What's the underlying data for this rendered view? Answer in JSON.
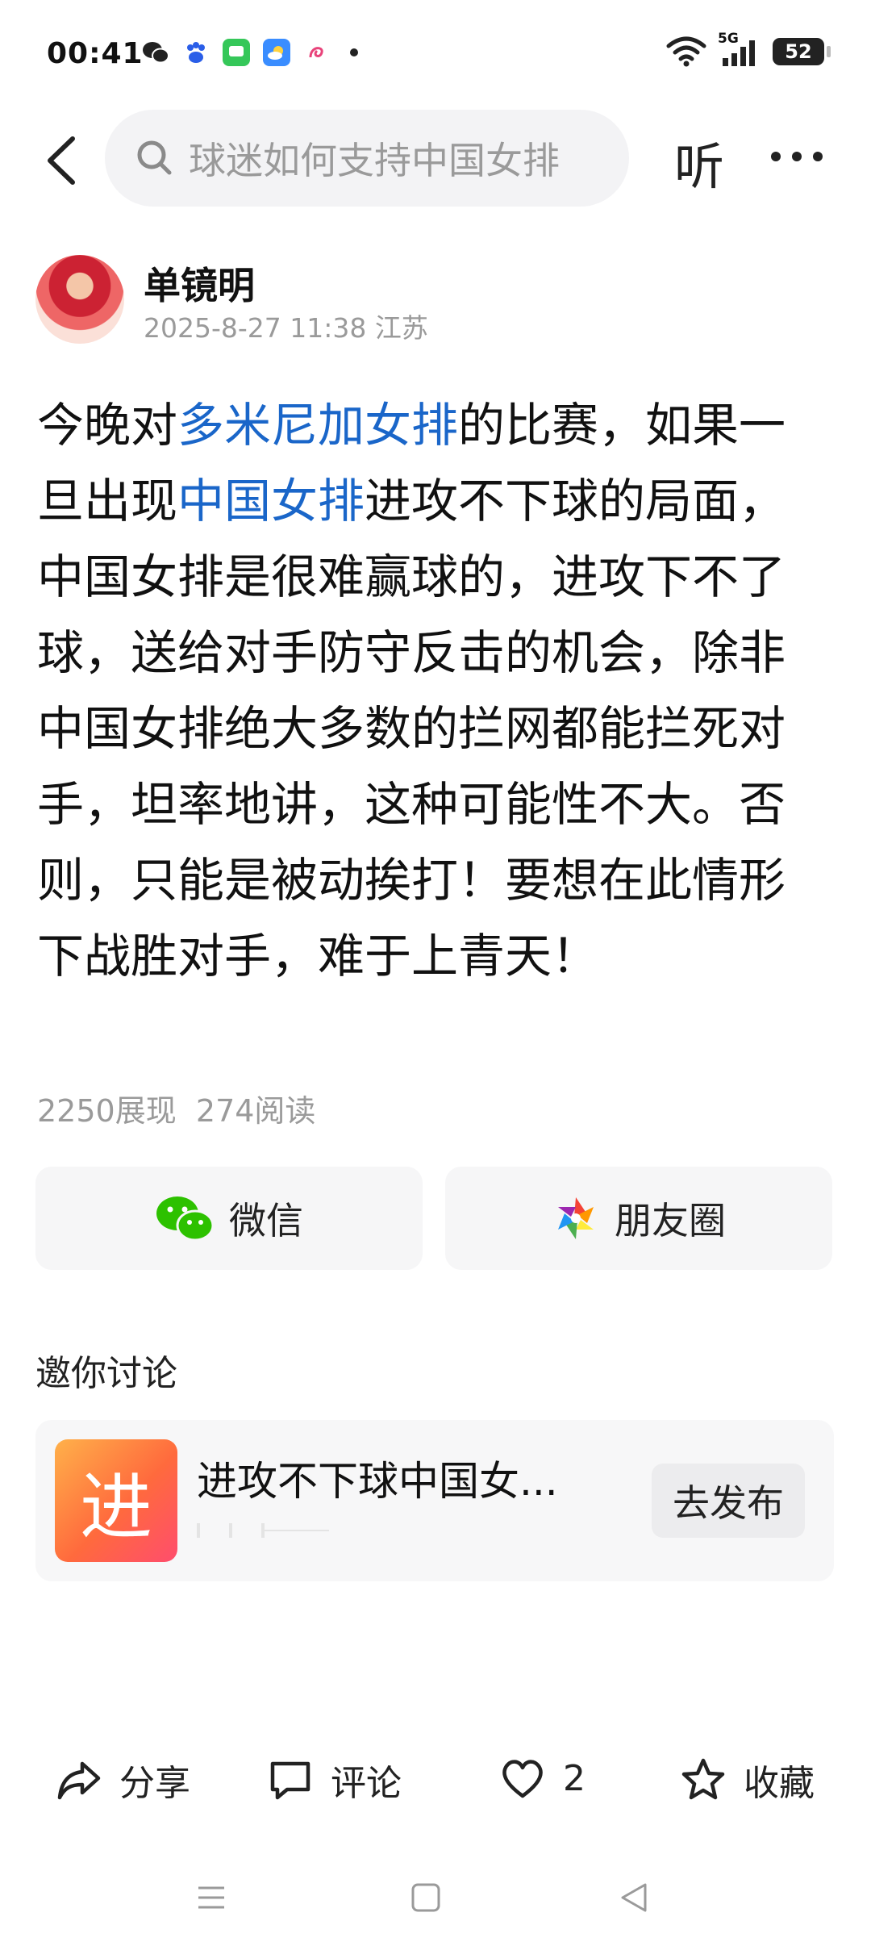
{
  "status_bar": {
    "time": "00:41",
    "network": "5G",
    "battery": "52"
  },
  "search": {
    "placeholder": "球迷如何支持中国女排"
  },
  "nav": {
    "listen_label": "听"
  },
  "post": {
    "author": "单镜明",
    "meta": "2025-8-27 11:38 江苏",
    "segments": [
      {
        "text": "今晚对",
        "hl": false
      },
      {
        "text": "多米尼加女排",
        "hl": true
      },
      {
        "text": "的比赛，如果一旦出现",
        "hl": false
      },
      {
        "text": "中国女排",
        "hl": true
      },
      {
        "text": "进攻不下球的局面，中国女排是很难赢球的，进攻下不了球，送给对手防守反击的机会，除非中国女排绝大多数的拦网都能拦死对手，坦率地讲，这种可能性不大。否则，只能是被动挨打！要想在此情形下战胜对手，难于上青天！",
        "hl": false
      }
    ],
    "views": "2250展现",
    "reads": "274阅读"
  },
  "share": {
    "wechat_label": "微信",
    "moments_label": "朋友圈"
  },
  "invite": {
    "title": "邀你讨论",
    "topic_char": "进",
    "topic_title": "进攻不下球中国女...",
    "publish_label": "去发布"
  },
  "actions": {
    "share": "分享",
    "comment": "评论",
    "like_count": "2",
    "favorite": "收藏"
  },
  "colors": {
    "link": "#1a66c9",
    "wechat_green": "#2dc100"
  }
}
